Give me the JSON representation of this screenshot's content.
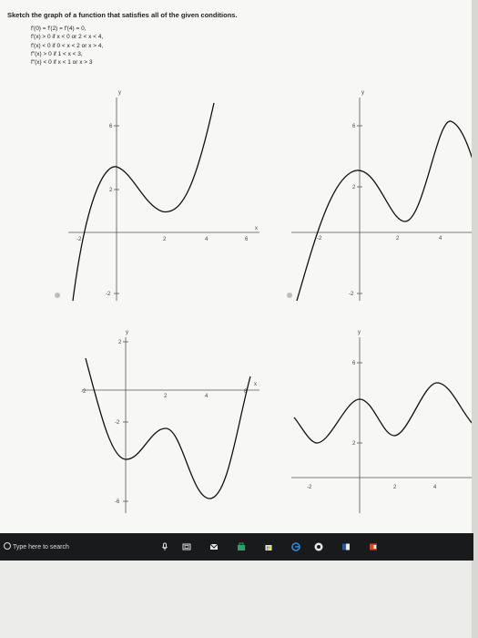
{
  "problem": {
    "prompt": "Sketch the graph of a function that satisfies all of the given conditions.",
    "conditions": [
      "f′(0) = f′(2) = f′(4) = 0,",
      "f′(x) > 0 if x < 0 or 2 < x < 4,",
      "f′(x) < 0 if 0 < x < 2 or x > 4,",
      "f″(x) > 0 if 1 < x < 3,",
      "f″(x) < 0 if x < 1 or x > 3"
    ]
  },
  "graphs": {
    "g1": {
      "ylabel": "y",
      "xlabel": "x",
      "yticks": [
        "6",
        "2",
        "-2"
      ],
      "xticks": [
        "-2",
        "2",
        "4",
        "6"
      ]
    },
    "g2": {
      "ylabel": "y",
      "yticks": [
        "6",
        "2",
        "-2"
      ],
      "xticks": [
        "-2",
        "2",
        "4"
      ]
    },
    "g3": {
      "ylabel": "y",
      "xlabel": "x",
      "yticks": [
        "2",
        "-2",
        "-6"
      ],
      "xticks": [
        "-2",
        "2",
        "4",
        "6"
      ]
    },
    "g4": {
      "ylabel": "y",
      "yticks": [
        "6",
        "2"
      ],
      "xticks": [
        "-2",
        "2",
        "4"
      ]
    }
  },
  "taskbar": {
    "search_placeholder": "Type here to search",
    "icons": [
      "microphone-icon",
      "task-view-icon",
      "mail-icon",
      "store-icon",
      "shopping-bag-icon",
      "edge-browser-icon",
      "chrome-icon",
      "word-icon",
      "powerpoint-icon"
    ]
  }
}
